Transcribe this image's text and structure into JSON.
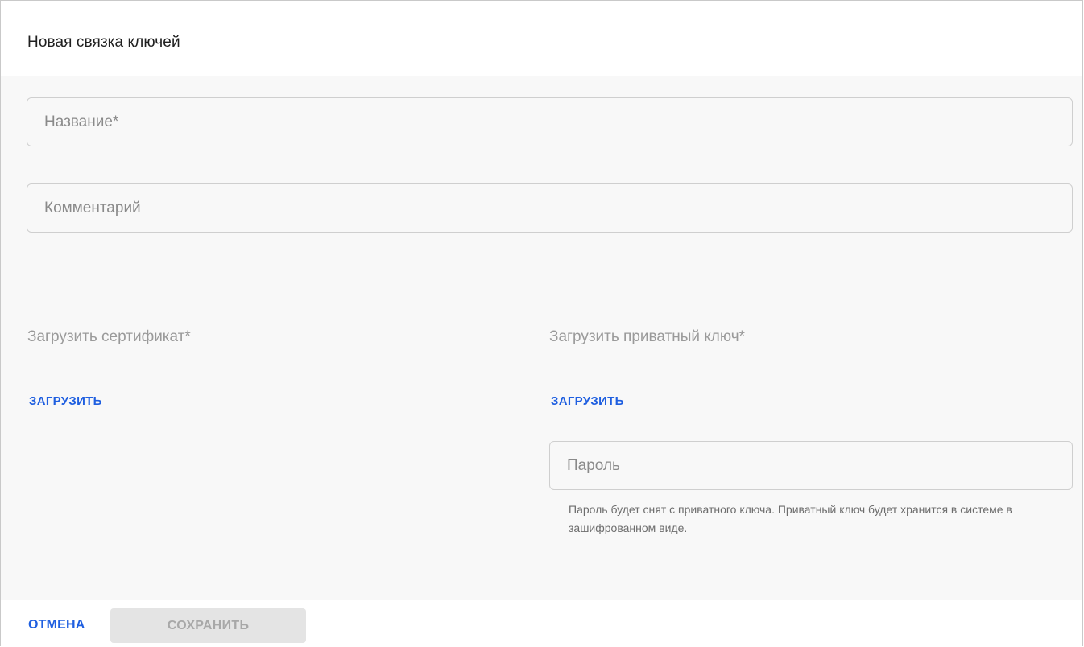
{
  "dialog": {
    "title": "Новая связка ключей"
  },
  "form": {
    "name": {
      "placeholder": "Название*",
      "value": ""
    },
    "comment": {
      "placeholder": "Комментарий",
      "value": ""
    },
    "certificate": {
      "label": "Загрузить сертификат*",
      "upload_label": "ЗАГРУЗИТЬ"
    },
    "private_key": {
      "label": "Загрузить приватный ключ*",
      "upload_label": "ЗАГРУЗИТЬ",
      "password": {
        "placeholder": "Пароль",
        "value": ""
      },
      "hint": "Пароль будет снят с приватного ключа. Приватный ключ будет хранится в системе в зашифрованном виде."
    }
  },
  "footer": {
    "cancel_label": "ОТМЕНА",
    "save_label": "СОХРАНИТЬ",
    "save_disabled": true
  },
  "colors": {
    "accent": "#1f5fe0",
    "body_background": "#f8f8f8",
    "disabled_button": "#e4e4e4"
  }
}
